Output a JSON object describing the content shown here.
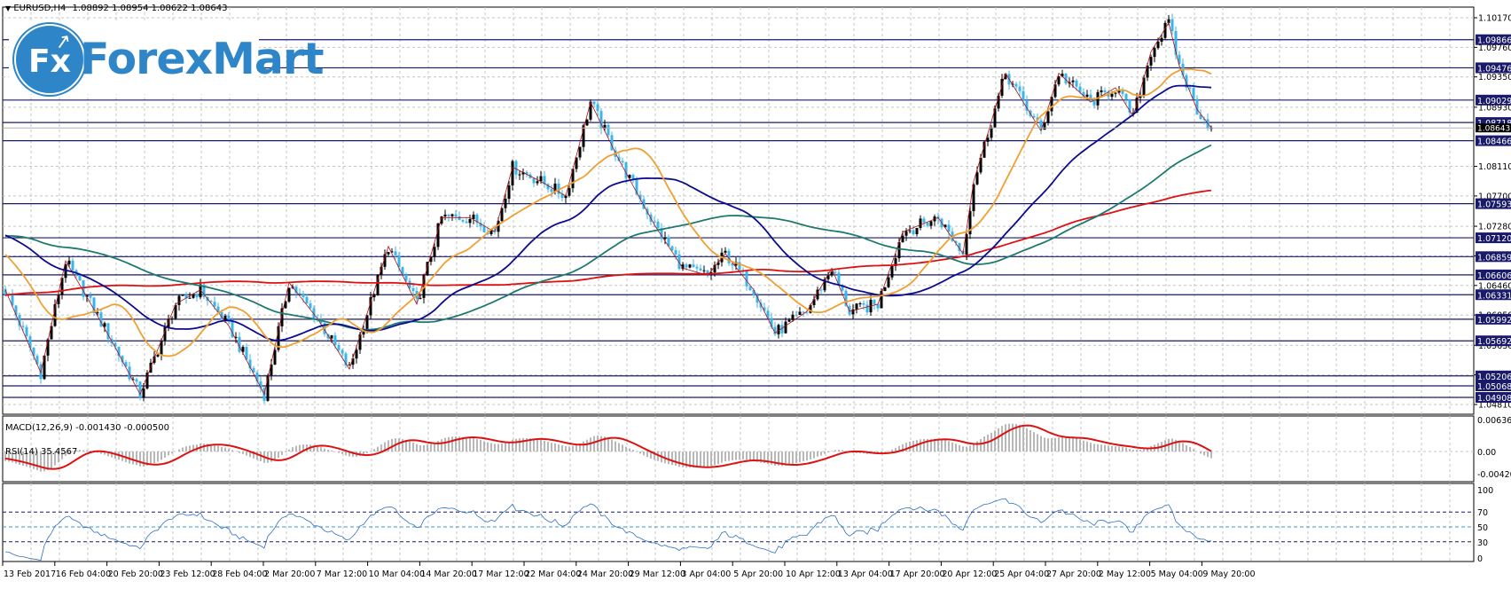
{
  "header": {
    "symbol": "EURUSD,H4",
    "ohlc": "1.08892 1.08954 1.08622 1.08643",
    "menu_icon": "triangle-down-icon"
  },
  "logo": {
    "mark": "Fx",
    "text": "ForexMart"
  },
  "macd": {
    "label": "MACD(12,26,9) -0.001430 -0.000500",
    "axis": [
      "0.00636",
      "0.00",
      "-0.004208"
    ]
  },
  "rsi": {
    "label": "RSI(14) 35.4567",
    "axis": [
      "100",
      "70",
      "50",
      "30",
      "0"
    ]
  },
  "colors": {
    "bull": "#000000",
    "bear": "#3ab4ec",
    "ma_fast": "#f0a030",
    "ma_mid": "#0c0c8c",
    "ma_slow": "#1e7a6e",
    "ma_long": "#dd1111",
    "level": "#1a1a6a",
    "zigzag": "#b01010",
    "macd_hist": "#b8b8b8",
    "macd_signal": "#dd1111",
    "rsi_line": "#2f6fc0"
  },
  "chart_data": {
    "type": "candlestick",
    "symbol": "EURUSD",
    "timeframe": "H4",
    "ylim": [
      1.0481,
      1.1017
    ],
    "price_axis": [
      "1.10170",
      "1.09760",
      "1.09350",
      "1.08930",
      "1.08110",
      "1.07700",
      "1.07280",
      "1.06870",
      "1.06460",
      "1.06050",
      "1.05630",
      "1.05220",
      "1.04810"
    ],
    "levels": [
      "1.09866",
      "1.09476",
      "1.09029",
      "1.08718",
      "1.08466",
      "1.07593",
      "1.07120",
      "1.06859",
      "1.06606",
      "1.06331",
      "1.05992",
      "1.05692",
      "1.05206",
      "1.05068",
      "1.04908"
    ],
    "current_price": "1.08643",
    "time_labels": [
      "13 Feb 2017",
      "16 Feb 04:00",
      "20 Feb 20:00",
      "23 Feb 12:00",
      "28 Feb 04:00",
      "2 Mar 20:00",
      "7 Mar 12:00",
      "10 Mar 04:00",
      "14 Mar 20:00",
      "17 Mar 12:00",
      "22 Mar 04:00",
      "24 Mar 20:00",
      "29 Mar 12:00",
      "3 Apr 04:00",
      "5 Apr 20:00",
      "10 Apr 12:00",
      "13 Apr 04:00",
      "17 Apr 20:00",
      "20 Apr 12:00",
      "25 Apr 04:00",
      "27 Apr 20:00",
      "2 May 12:00",
      "5 May 04:00",
      "9 May 20:00"
    ],
    "close_path_bar_price": [
      [
        -200,
        1.05
      ],
      [
        -100,
        1.06
      ],
      [
        -89,
        1.072
      ],
      [
        -26,
        1.074
      ],
      [
        -11,
        1.07
      ],
      [
        0,
        1.064
      ],
      [
        10,
        1.0525
      ],
      [
        17,
        1.068
      ],
      [
        23,
        1.063
      ],
      [
        31,
        1.056
      ],
      [
        38,
        1.0495
      ],
      [
        48,
        1.062
      ],
      [
        55,
        1.064
      ],
      [
        63,
        1.059
      ],
      [
        73,
        1.0495
      ],
      [
        80,
        1.065
      ],
      [
        88,
        1.06
      ],
      [
        97,
        1.053
      ],
      [
        108,
        1.07
      ],
      [
        116,
        1.062
      ],
      [
        123,
        1.074
      ],
      [
        131,
        1.074
      ],
      [
        138,
        1.072
      ],
      [
        143,
        1.081
      ],
      [
        151,
        1.079
      ],
      [
        158,
        1.077
      ],
      [
        165,
        1.09
      ],
      [
        173,
        1.082
      ],
      [
        183,
        1.073
      ],
      [
        191,
        1.067
      ],
      [
        198,
        1.066
      ],
      [
        203,
        1.069
      ],
      [
        211,
        1.064
      ],
      [
        217,
        1.058
      ],
      [
        226,
        1.061
      ],
      [
        233,
        1.067
      ],
      [
        238,
        1.061
      ],
      [
        246,
        1.062
      ],
      [
        253,
        1.072
      ],
      [
        263,
        1.074
      ],
      [
        270,
        1.069
      ],
      [
        273,
        1.079
      ],
      [
        282,
        1.094
      ],
      [
        292,
        1.086
      ],
      [
        297,
        1.094
      ],
      [
        306,
        1.09
      ],
      [
        313,
        1.092
      ],
      [
        318,
        1.088
      ],
      [
        323,
        1.097
      ],
      [
        328,
        1.101
      ],
      [
        331,
        1.095
      ],
      [
        336,
        1.089
      ],
      [
        340,
        1.08643
      ]
    ],
    "indicators": [
      "MA 20",
      "MA 50",
      "MA 100",
      "MA 200",
      "ZigZag",
      "MACD(12,26,9)",
      "RSI(14)"
    ]
  }
}
